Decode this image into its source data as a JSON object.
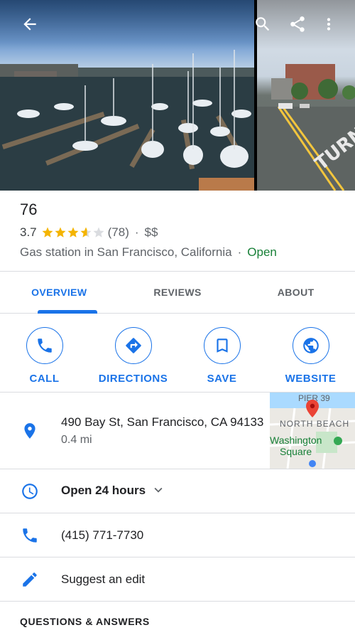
{
  "hero": {
    "side_photo_street_text": "TURN"
  },
  "map_thumb": {
    "label_pier": "PIER 39",
    "label_north_beach": "NORTH BEACH",
    "label_washington": "Washington",
    "label_square": "Square"
  },
  "place": {
    "name": "76",
    "rating": "3.7",
    "review_count": "(78)",
    "price": "$$",
    "category": "Gas station in San Francisco, California",
    "separator": "·",
    "status": "Open"
  },
  "tabs": [
    {
      "label": "OVERVIEW",
      "active": true
    },
    {
      "label": "REVIEWS",
      "active": false
    },
    {
      "label": "ABOUT",
      "active": false
    }
  ],
  "actions": [
    {
      "label": "CALL",
      "icon": "phone-icon"
    },
    {
      "label": "DIRECTIONS",
      "icon": "directions-icon"
    },
    {
      "label": "SAVE",
      "icon": "bookmark-icon"
    },
    {
      "label": "WEBSITE",
      "icon": "globe-icon"
    }
  ],
  "address": {
    "line": "490 Bay St, San Francisco, CA 94133",
    "distance": "0.4 mi"
  },
  "hours": {
    "text": "Open 24 hours"
  },
  "phone": {
    "number": "(415) 771-7730"
  },
  "edit": {
    "label": "Suggest an edit"
  },
  "qa": {
    "header": "QUESTIONS & ANSWERS"
  },
  "colors": {
    "accent": "#1a73e8",
    "open_green": "#188038",
    "star_gold": "#f4b400"
  }
}
